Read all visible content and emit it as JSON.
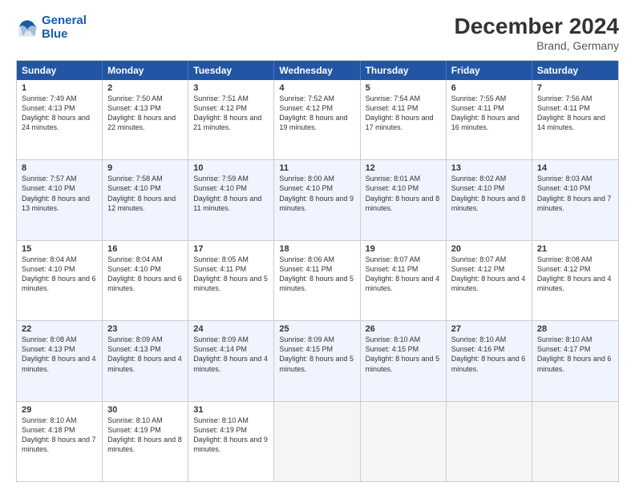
{
  "logo": {
    "line1": "General",
    "line2": "Blue"
  },
  "title": "December 2024",
  "subtitle": "Brand, Germany",
  "days": [
    "Sunday",
    "Monday",
    "Tuesday",
    "Wednesday",
    "Thursday",
    "Friday",
    "Saturday"
  ],
  "weeks": [
    [
      {
        "num": "1",
        "rise": "7:49 AM",
        "set": "4:13 PM",
        "daylight": "8 hours and 24 minutes."
      },
      {
        "num": "2",
        "rise": "7:50 AM",
        "set": "4:13 PM",
        "daylight": "8 hours and 22 minutes."
      },
      {
        "num": "3",
        "rise": "7:51 AM",
        "set": "4:12 PM",
        "daylight": "8 hours and 21 minutes."
      },
      {
        "num": "4",
        "rise": "7:52 AM",
        "set": "4:12 PM",
        "daylight": "8 hours and 19 minutes."
      },
      {
        "num": "5",
        "rise": "7:54 AM",
        "set": "4:11 PM",
        "daylight": "8 hours and 17 minutes."
      },
      {
        "num": "6",
        "rise": "7:55 AM",
        "set": "4:11 PM",
        "daylight": "8 hours and 16 minutes."
      },
      {
        "num": "7",
        "rise": "7:56 AM",
        "set": "4:11 PM",
        "daylight": "8 hours and 14 minutes."
      }
    ],
    [
      {
        "num": "8",
        "rise": "7:57 AM",
        "set": "4:10 PM",
        "daylight": "8 hours and 13 minutes."
      },
      {
        "num": "9",
        "rise": "7:58 AM",
        "set": "4:10 PM",
        "daylight": "8 hours and 12 minutes."
      },
      {
        "num": "10",
        "rise": "7:59 AM",
        "set": "4:10 PM",
        "daylight": "8 hours and 11 minutes."
      },
      {
        "num": "11",
        "rise": "8:00 AM",
        "set": "4:10 PM",
        "daylight": "8 hours and 9 minutes."
      },
      {
        "num": "12",
        "rise": "8:01 AM",
        "set": "4:10 PM",
        "daylight": "8 hours and 8 minutes."
      },
      {
        "num": "13",
        "rise": "8:02 AM",
        "set": "4:10 PM",
        "daylight": "8 hours and 8 minutes."
      },
      {
        "num": "14",
        "rise": "8:03 AM",
        "set": "4:10 PM",
        "daylight": "8 hours and 7 minutes."
      }
    ],
    [
      {
        "num": "15",
        "rise": "8:04 AM",
        "set": "4:10 PM",
        "daylight": "8 hours and 6 minutes."
      },
      {
        "num": "16",
        "rise": "8:04 AM",
        "set": "4:10 PM",
        "daylight": "8 hours and 6 minutes."
      },
      {
        "num": "17",
        "rise": "8:05 AM",
        "set": "4:11 PM",
        "daylight": "8 hours and 5 minutes."
      },
      {
        "num": "18",
        "rise": "8:06 AM",
        "set": "4:11 PM",
        "daylight": "8 hours and 5 minutes."
      },
      {
        "num": "19",
        "rise": "8:07 AM",
        "set": "4:11 PM",
        "daylight": "8 hours and 4 minutes."
      },
      {
        "num": "20",
        "rise": "8:07 AM",
        "set": "4:12 PM",
        "daylight": "8 hours and 4 minutes."
      },
      {
        "num": "21",
        "rise": "8:08 AM",
        "set": "4:12 PM",
        "daylight": "8 hours and 4 minutes."
      }
    ],
    [
      {
        "num": "22",
        "rise": "8:08 AM",
        "set": "4:13 PM",
        "daylight": "8 hours and 4 minutes."
      },
      {
        "num": "23",
        "rise": "8:09 AM",
        "set": "4:13 PM",
        "daylight": "8 hours and 4 minutes."
      },
      {
        "num": "24",
        "rise": "8:09 AM",
        "set": "4:14 PM",
        "daylight": "8 hours and 4 minutes."
      },
      {
        "num": "25",
        "rise": "8:09 AM",
        "set": "4:15 PM",
        "daylight": "8 hours and 5 minutes."
      },
      {
        "num": "26",
        "rise": "8:10 AM",
        "set": "4:15 PM",
        "daylight": "8 hours and 5 minutes."
      },
      {
        "num": "27",
        "rise": "8:10 AM",
        "set": "4:16 PM",
        "daylight": "8 hours and 6 minutes."
      },
      {
        "num": "28",
        "rise": "8:10 AM",
        "set": "4:17 PM",
        "daylight": "8 hours and 6 minutes."
      }
    ],
    [
      {
        "num": "29",
        "rise": "8:10 AM",
        "set": "4:18 PM",
        "daylight": "8 hours and 7 minutes."
      },
      {
        "num": "30",
        "rise": "8:10 AM",
        "set": "4:19 PM",
        "daylight": "8 hours and 8 minutes."
      },
      {
        "num": "31",
        "rise": "8:10 AM",
        "set": "4:19 PM",
        "daylight": "8 hours and 9 minutes."
      },
      null,
      null,
      null,
      null
    ]
  ]
}
